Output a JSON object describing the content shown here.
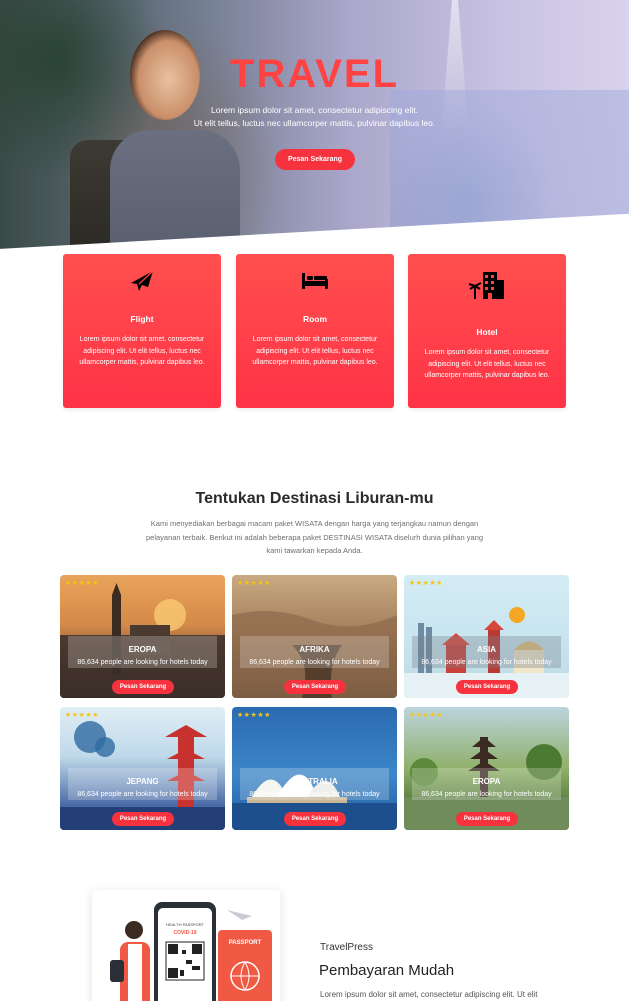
{
  "hero": {
    "title": "TRAVEL",
    "subtitle_line1": "Lorem ipsum dolor sit amet, consectetur adipiscing elit.",
    "subtitle_line2": "Ut elit tellus, luctus nec ullamcorper mattis, pulvinar dapibus leo.",
    "button": "Pesan Sekarang",
    "title_color": "#ff4242",
    "button_color": "#f7323f"
  },
  "services": [
    {
      "icon": "airplane-icon",
      "name": "Flight",
      "desc": "Lorem ipsum dolor sit amet, consectetur adipiscing elit. Ut elit tellus, luctus nec ullamcorper mattis, pulvinar dapibus leo."
    },
    {
      "icon": "bed-icon",
      "name": "Room",
      "desc": "Lorem ipsum dolor sit amet, consectetur adipiscing elit. Ut elit tellus, luctus nec ullamcorper mattis, pulvinar dapibus leo."
    },
    {
      "icon": "hotel-building-icon",
      "name": "Hotel",
      "desc": "Lorem ipsum dolor sit amet, consectetur adipiscing elit. Ut elit tellus, luctus nec ullamcorper mattis, pulvinar dapibus leo."
    }
  ],
  "destinations": {
    "title": "Tentukan Destinasi Liburan-mu",
    "description": "Kami menyediakan berbagai macam paket WISATA dengan harga yang terjangkau namun dengan pelayanan terbaik. Berikut ini adalah beberapa paket DESTINASI WISATA diselurh dunia pilihan yang kami tawarkan kepada Anda.",
    "items": [
      {
        "name": "EROPA",
        "stars": "★★★★★",
        "count": "86,634 people are looking for hotels today",
        "button": "Pesan Sekarang"
      },
      {
        "name": "AFRIKA",
        "stars": "★★★★★",
        "count": "86,634 people are looking for hotels today",
        "button": "Pesan Sekarang"
      },
      {
        "name": "ASIA",
        "stars": "★★★★★",
        "count": "86,634 people are looking for hotels today",
        "button": "Pesan Sekarang"
      },
      {
        "name": "JEPANG",
        "stars": "★★★★★",
        "count": "86,634 people are looking for hotels today",
        "button": "Pesan Sekarang"
      },
      {
        "name": "AUSTRALIA",
        "stars": "★★★★★",
        "count": "86,634 people are looking for hotels today",
        "button": "Pesan Sekarang"
      },
      {
        "name": "EROPA",
        "stars": "★★★★★",
        "count": "86,634 people are looking for hotels today",
        "button": "Pesan Sekarang"
      }
    ]
  },
  "payment": {
    "brand": "TravelPress",
    "title": "Pembayaran Mudah",
    "text": "Lorem ipsum dolor sit amet, consectetur adipiscing elit. Ut elit",
    "passport_label": "PASSPORT",
    "health_label": "HEALTH PASSPORT",
    "covid_label": "COVID-19"
  }
}
